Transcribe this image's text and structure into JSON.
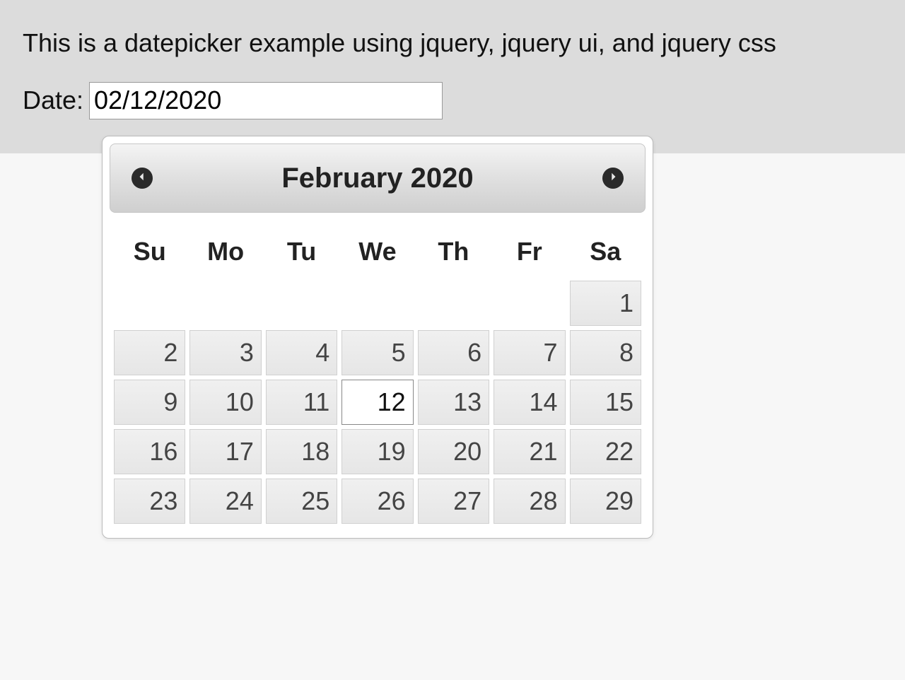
{
  "page": {
    "title": "This is a datepicker example using jquery, jquery ui, and jquery css",
    "date_label": "Date:",
    "date_value": "02/12/2020"
  },
  "datepicker": {
    "month_year": "February 2020",
    "days_short": [
      "Su",
      "Mo",
      "Tu",
      "We",
      "Th",
      "Fr",
      "Sa"
    ],
    "selected_day": 12,
    "weeks": [
      [
        null,
        null,
        null,
        null,
        null,
        null,
        1
      ],
      [
        2,
        3,
        4,
        5,
        6,
        7,
        8
      ],
      [
        9,
        10,
        11,
        12,
        13,
        14,
        15
      ],
      [
        16,
        17,
        18,
        19,
        20,
        21,
        22
      ],
      [
        23,
        24,
        25,
        26,
        27,
        28,
        29
      ]
    ]
  }
}
